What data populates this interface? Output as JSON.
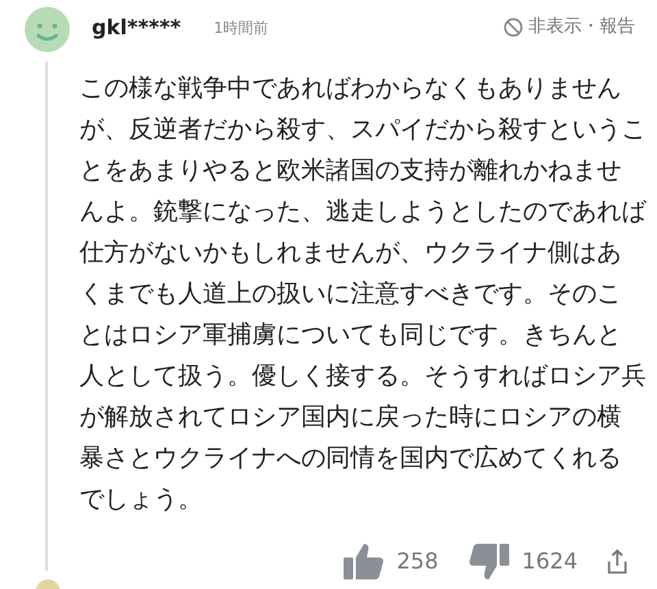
{
  "comment": {
    "user": "gkl*****",
    "time": "1時間前",
    "hide_report": "非表示・報告",
    "body_lines": [
      "この様な戦争中であればわからなくもありません",
      "が、反逆者だから殺す、スパイだから殺すというこ",
      "とをあまりやると欧米諸国の支持が離れかねませ",
      "んよ。銃撃になった、逃走しようとしたのであれば",
      "仕方がないかもしれませんが、ウクライナ側はあ",
      "くまでも人道上の扱いに注意すべきです。そのこ",
      "とはロシア軍捕虜についても同じです。きちんと",
      "人として扱う。優しく接する。そうすればロシア兵",
      "が解放されてロシア国内に戻った時にロシアの横",
      "暴さとウクライナへの同情を国内で広めてくれる",
      "でしょう。"
    ],
    "likes": "258",
    "dislikes": "1624"
  }
}
